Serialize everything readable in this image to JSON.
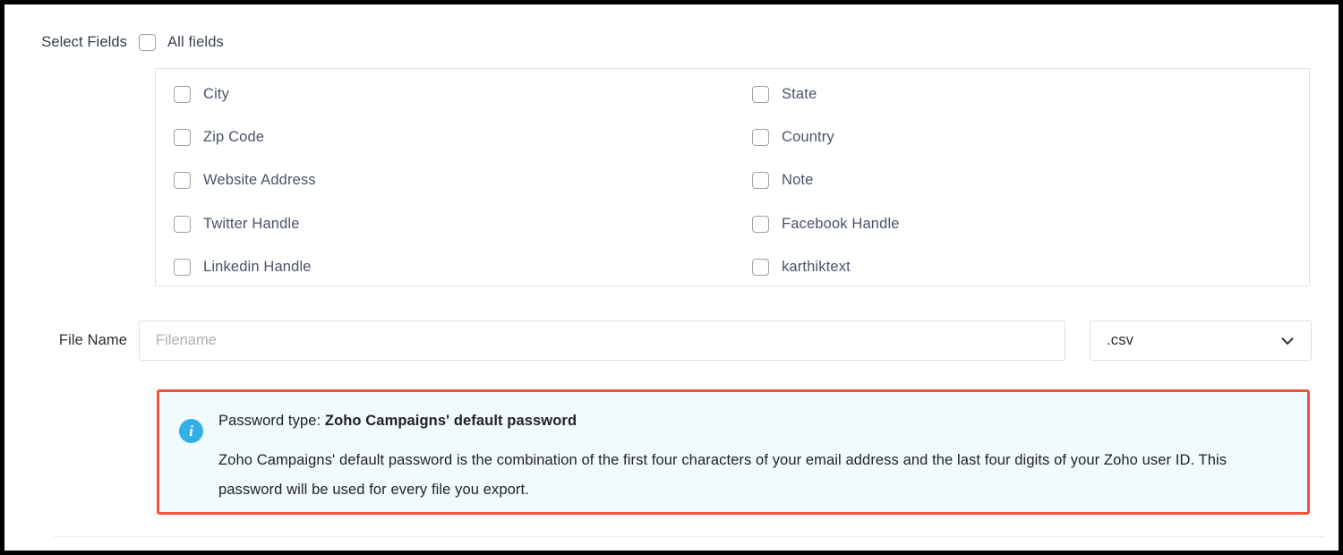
{
  "form": {
    "select_fields_label": "Select Fields",
    "all_fields_label": "All fields",
    "all_fields_checked": false,
    "file_name_label": "File Name",
    "file_name_value": "",
    "file_name_placeholder": "Filename",
    "extension_selected": ".csv",
    "extension_icon": "chevron-down-icon"
  },
  "fields": [
    {
      "label": "City",
      "checked": false
    },
    {
      "label": "State",
      "checked": false
    },
    {
      "label": "Zip Code",
      "checked": false
    },
    {
      "label": "Country",
      "checked": false
    },
    {
      "label": "Website Address",
      "checked": false
    },
    {
      "label": "Note",
      "checked": false
    },
    {
      "label": "Twitter Handle",
      "checked": false
    },
    {
      "label": "Facebook Handle",
      "checked": false
    },
    {
      "label": "Linkedin Handle",
      "checked": false
    },
    {
      "label": "karthiktext",
      "checked": false
    }
  ],
  "info_box": {
    "icon": "info-circle-icon",
    "icon_glyph": "i",
    "title_prefix": "Password type: ",
    "title_strong": "Zoho Campaigns' default password",
    "body": "Zoho Campaigns' default password is the combination of the first four characters of your email address and the last four digits of your Zoho user ID. This password will be used for every file you export.",
    "border_color": "#f4543a",
    "background_color": "#f0fbfd",
    "icon_color": "#31b0e8"
  }
}
